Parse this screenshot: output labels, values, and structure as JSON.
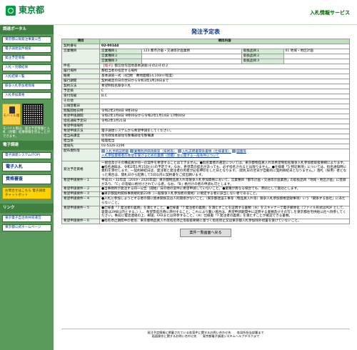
{
  "header": {
    "logo_text": "東京都",
    "service_title": "入札情報サービス"
  },
  "sidebar": {
    "section1": "調達ポータル",
    "items": [
      "東京都公報発注事業公告",
      "電子調達案件検索",
      "発注予定情報",
      "入札・見積結果",
      "入札結果一覧",
      "競争入札参加者情報",
      "入札参加資格",
      "入札参加資格関係"
    ],
    "mobile_label": "モバイル版",
    "mobile_note": "モバイル版は、発注予定情報と入札（見積）結果情報を見ることができます。",
    "section2": "電子調達",
    "items2": [
      "電子調達システム(TOP)"
    ],
    "big_buttons": [
      "電子入札",
      "資格審査"
    ],
    "yellow_button": "お問合せはこちら 電子調達チャットボット",
    "section3": "リンク",
    "links": [
      "東京電子自治体共同運営",
      "東京都公式ホームページ"
    ]
  },
  "main": {
    "title": "発注予定表",
    "col_item": "項目",
    "col_content": "項目内容",
    "rows": {
      "keiyaku_no": {
        "label": "契約番号",
        "value": "02-00144"
      },
      "eigyo": {
        "label": "営業種目",
        "sub": [
          "営業種目１",
          "営業種目２",
          "営業種目３"
        ],
        "vals": [
          "123 都市計画・交通等計画業務",
          "",
          ""
        ],
        "kubun": [
          "取扱品目１",
          "取扱品目２",
          "取扱品目３"
        ],
        "kubun_vals": [
          "01 地域・地区計画",
          "",
          ""
        ]
      },
      "kenmei": {
        "label": "件名",
        "tag": "【電子】",
        "value": "都営住宅団地基本調査(その2)その２"
      },
      "basho": {
        "label": "履行場所",
        "value": "都担当者の指定する場所"
      },
      "gaiyo": {
        "label": "概要",
        "value": "基本調査一式（4団地　敷地面積14,100ｍ²程度）"
      },
      "kikan": {
        "label": "履行期間",
        "value": "契約確定の日の翌日から令和3年3月29日まで"
      },
      "hoho": {
        "label": "契約方法",
        "value": "希望制指名競争入札"
      },
      "bunrui": {
        "label": "予定価",
        "value": "C"
      },
      "uketsuke": {
        "label": "受付等級",
        "value": "B,C"
      },
      "sonota": {
        "label": "その他",
        "value": ""
      },
      "kohyo": {
        "label": "公報登載日",
        "value": ""
      },
      "kaishi": {
        "label": "閲覧開始日時",
        "value": "令和2年2月8日 9時30分"
      },
      "kibo": {
        "label": "希望申請期間",
        "value": "令和2年1月8日 9時00分から令和2年1月14日 17時00分"
      },
      "shitei": {
        "label": "指名通知予定日",
        "value": "令和2年1月21日"
      },
      "basho2": {
        "label": "希望申請場所",
        "value": ""
      },
      "hoho2": {
        "label": "希望申請方法",
        "value": "電子調達システムから希望申請をしてください。"
      },
      "tanto": {
        "label": "担当局課室",
        "value": "住宅政策本部住宅整備部住宅整備課"
      },
      "tanto2": {
        "label": "担当係",
        "value": "経理担当"
      },
      "tel": {
        "label": "連絡先",
        "value": "03-5326-2296"
      },
      "haifu": {
        "label": "配布資料等",
        "links": [
          "入札手続説明書",
          "業種別評価項目等（技術等）",
          "入札説明書関係書類（仕様書等）",
          "図面等"
        ],
        "link2": "入札参加資格者の希望を受けるための業務（見積）等に関する一般条件について",
        "link3": "東京都電子調達システムの利用に関する規約（電子入札・審査システム）"
      },
      "joken": {
        "label": "発注予定資格",
        "value": "一組合及びその構成員が同一の案件を希望することはできません。●指名業者の選定については、東京都物品買入れ等希望制指名競争入札参加者取扱要綱によります。●指名通知は、令和2年1月15日(火)の予定です。なお、希望票の提出があっても、必ず指名されるとは限りません。●仕様書「5 特記事項」については、指名通知時に資料を添付します。一契約締結日は、発注者と発注者の両者が記名押印をした日となります。（開札日の翌日が自動的に契約締結日となりません。）落札（採用）者となった場合は、開札日から起算して5日以内に契約書をご提出願います。"
      },
      "req1": {
        "label": "希望申請要件－１",
        "value": "平成31・32年度（2019・2020年度）東京都物品買入れ等競争入札参加資格において、営業種目「都市計画・交通等計画業務」の取扱品目「地域・地区計画」に登録があり、「C」の等級に格付けされている者。なお、「B」格付けの者の申請も可とします。"
      },
      "req2": {
        "label": "希望申請要件－２",
        "value": "●当事務所が発注する同一公告（開始）日の他の案件に希望申請していないこと。●業種が異なる場合でも、原則として無効とします。"
      },
      "req3": {
        "label": "希望申請要件－３",
        "value": "●東京都契約関係事務規則第23条（一般競争入札参加者の資格）に規定する者に該当しない者であること。"
      },
      "req4": {
        "label": "希望申請要件－４",
        "value": "●入札に参加しようとする者の間に資本関係又は人的関係がないこと。（東京都建設工事等（物品買入れ等）競争入札参加資格登録事項）いう「関係する会社」にあたらないこと。"
      },
      "req5": {
        "label": "希望申請要件－５",
        "value": "●仕様書「7 発注者の義務」を満たすこと。●仕様書「7 発注者の義務」を満たすことを証明する書類（※）をスキャナーで電子媒体化（ファイル形式はPDF として、容量は2MB以内とする。）し、希望票提出時に添付すること。これにより難い場合は、希望申請期間中に証明する書類及びその写しを東京都住宅供給公社へ持参してください。事前に電話連絡の上、郵送、FAXまたは持参すること。（※）仕様書「7 発注者の義務」を満たすことが確認できる書類。"
      },
      "req6": {
        "label": "希望申請要件－６",
        "value": "●指名停止期間中の者等、東京都物品買入れ等指名停止等取扱要綱に基づく指名停止又は東京都入札参加除外措置を受けていないこと。"
      }
    },
    "back_button": "案件一覧画面へ戻る"
  },
  "footer": {
    "line1": "発注予定情報に掲載されている各案件に関するお問い合わせ先　　各局所担当部署まで",
    "line2": "画面操作に関するお問い合わせ先　　東京都電子調達システムヘルプデスクまで"
  }
}
